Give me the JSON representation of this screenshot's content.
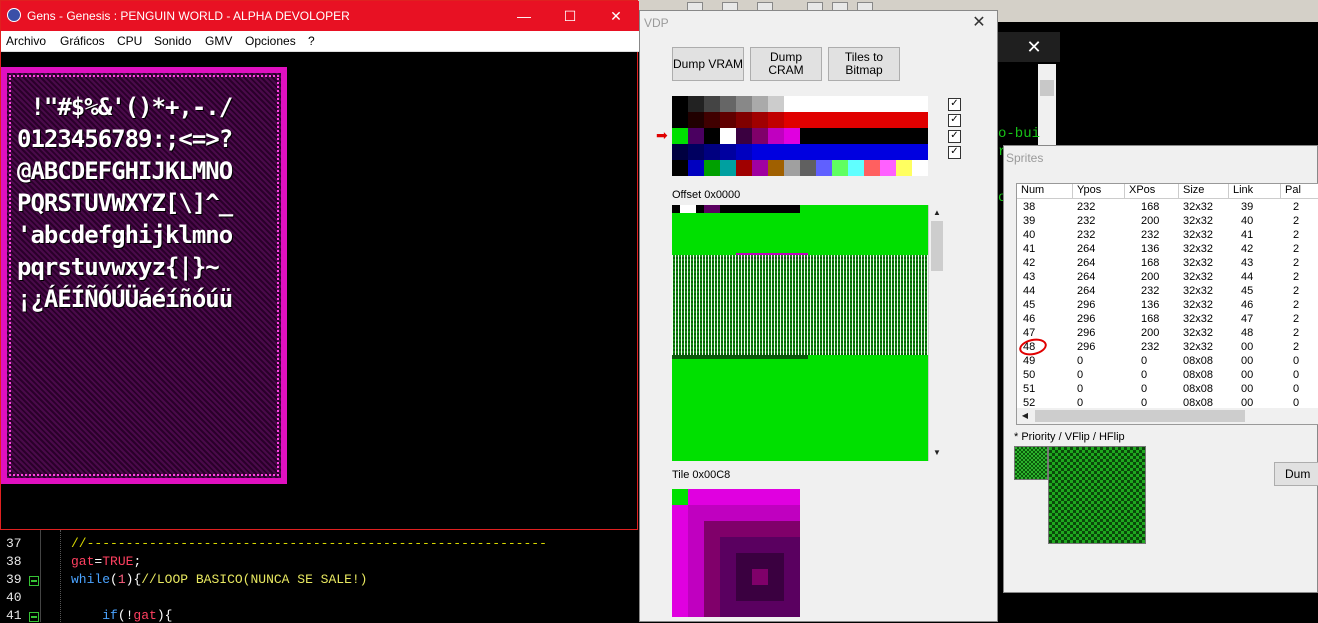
{
  "gens": {
    "title": "Gens - Genesis : PENGUIN WORLD - ALPHA DEVOLOPER",
    "minimize": "—",
    "maximize": "☐",
    "close": "✕",
    "menu": [
      "Archivo",
      "Gráficos",
      "CPU",
      "Sonido",
      "GMV",
      "Opciones",
      "?"
    ],
    "font_rows": [
      " !\"#$%&'()*+,-./",
      "0123456789:;<=>?",
      "@ABCDEFGHIJKLMNO",
      "PQRSTUVWXYZ[\\]^_",
      "'abcdefghijklmno",
      "pqrstuvwxyz{|}~",
      "¡¿ÁÉÍÑÓÚÜáéíñóúü"
    ]
  },
  "editor": {
    "lines": [
      {
        "num": "37",
        "text": "//-----------------------------------------------------------"
      },
      {
        "num": "38",
        "text": "gat=TRUE;"
      },
      {
        "num": "39",
        "text": "while(1){//LOOP BASICO(NUNCA SE SALE!)"
      },
      {
        "num": "40",
        "text": ""
      },
      {
        "num": "41",
        "text": "    if(!gat){"
      }
    ]
  },
  "terminal": {
    "close": "✕",
    "fragment1": "o-bui",
    "fragment2": "r",
    "fragment3": "o"
  },
  "vdp": {
    "title": "VDP",
    "close": "✕",
    "dump_vram": "Dump VRAM",
    "dump_cram": "Dump CRAM",
    "tiles_to_bitmap": "Tiles to Bitmap",
    "check": "✓",
    "selected_marker": "➡",
    "offset_label": "Offset 0x0000",
    "tile_label": "Tile 0x00C8",
    "palettes": [
      [
        "#000000",
        "#222222",
        "#444444",
        "#666666",
        "#888888",
        "#aaaaaa",
        "#cccccc",
        "#ffffff",
        "#ffffff",
        "#ffffff",
        "#ffffff",
        "#ffffff",
        "#ffffff",
        "#ffffff",
        "#ffffff",
        "#ffffff"
      ],
      [
        "#000000",
        "#200000",
        "#400000",
        "#600000",
        "#800000",
        "#a00000",
        "#c00000",
        "#e00000",
        "#e00000",
        "#e00000",
        "#e00000",
        "#e00000",
        "#e00000",
        "#e00000",
        "#e00000",
        "#e00000"
      ],
      [
        "#00e000",
        "#4a0060",
        "#000000",
        "#ffffff",
        "#3a0040",
        "#80006a",
        "#c000c0",
        "#e000e0",
        "#000000",
        "#000000",
        "#000000",
        "#000000",
        "#000000",
        "#000000",
        "#000000",
        "#000000"
      ],
      [
        "#000040",
        "#000060",
        "#000080",
        "#0000a0",
        "#0000c0",
        "#0000e0",
        "#0000e0",
        "#0000e0",
        "#0000e0",
        "#0000e0",
        "#0000e0",
        "#0000e0",
        "#0000e0",
        "#0000e0",
        "#0000e0",
        "#0000e0"
      ],
      [
        "#000000",
        "#0000c0",
        "#00a000",
        "#00a0a0",
        "#a00000",
        "#a000a0",
        "#a06000",
        "#a0a0a0",
        "#606060",
        "#6060ff",
        "#60ff60",
        "#60ffff",
        "#ff6060",
        "#ff60ff",
        "#ffff60",
        "#ffffff"
      ]
    ]
  },
  "sprites": {
    "title": "Sprites",
    "columns": [
      "Num",
      "Ypos",
      "XPos",
      "Size",
      "Link",
      "Pal"
    ],
    "rows": [
      [
        "38",
        "232",
        "168",
        "32x32",
        "39",
        "2"
      ],
      [
        "39",
        "232",
        "200",
        "32x32",
        "40",
        "2"
      ],
      [
        "40",
        "232",
        "232",
        "32x32",
        "41",
        "2"
      ],
      [
        "41",
        "264",
        "136",
        "32x32",
        "42",
        "2"
      ],
      [
        "42",
        "264",
        "168",
        "32x32",
        "43",
        "2"
      ],
      [
        "43",
        "264",
        "200",
        "32x32",
        "44",
        "2"
      ],
      [
        "44",
        "264",
        "232",
        "32x32",
        "45",
        "2"
      ],
      [
        "45",
        "296",
        "136",
        "32x32",
        "46",
        "2"
      ],
      [
        "46",
        "296",
        "168",
        "32x32",
        "47",
        "2"
      ],
      [
        "47",
        "296",
        "200",
        "32x32",
        "48",
        "2"
      ],
      [
        "48",
        "296",
        "232",
        "32x32",
        "00",
        "2"
      ],
      [
        "49",
        "0",
        "0",
        "08x08",
        "00",
        "0"
      ],
      [
        "50",
        "0",
        "0",
        "08x08",
        "00",
        "0"
      ],
      [
        "51",
        "0",
        "0",
        "08x08",
        "00",
        "0"
      ],
      [
        "52",
        "0",
        "0",
        "08x08",
        "00",
        "0"
      ]
    ],
    "flags_label": "* Priority / VFlip / HFlip",
    "dump_button": "Dum"
  }
}
